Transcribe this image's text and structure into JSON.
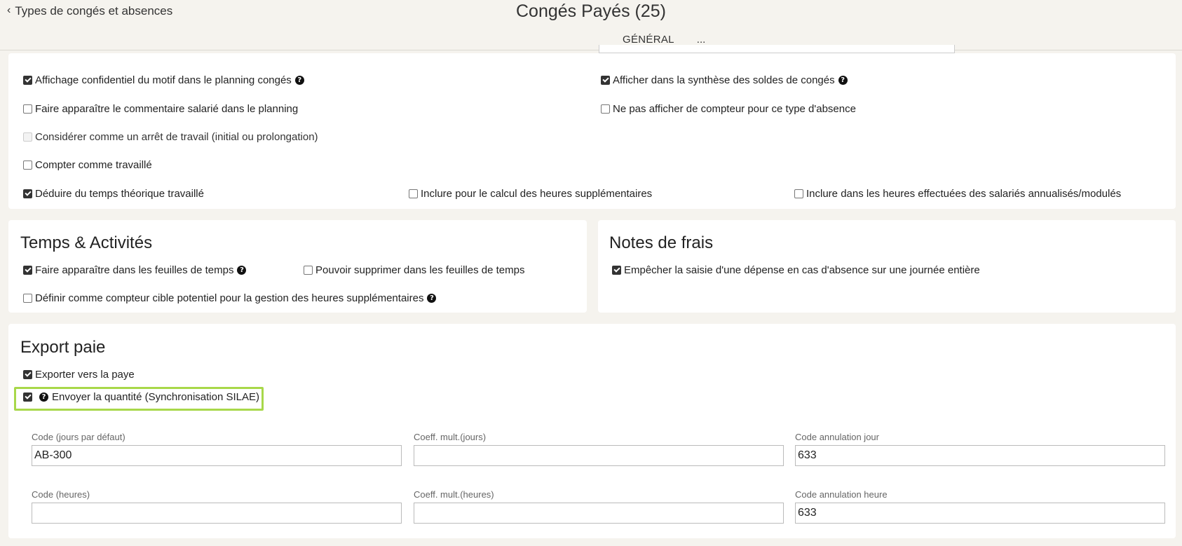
{
  "header": {
    "back_label": "Types de congés et absences",
    "title": "Congés Payés (25)",
    "tabs": [
      {
        "label": "GÉNÉRAL",
        "active": true
      },
      {
        "label": "..."
      }
    ]
  },
  "general": {
    "options": [
      {
        "label": "Affichage confidentiel du motif dans le planning congés",
        "checked": true,
        "help": true
      },
      {
        "label": "Afficher dans la synthèse des soldes de congés",
        "checked": true,
        "help": true
      },
      {
        "label": "Faire apparaître le commentaire salarié dans le planning",
        "checked": false
      },
      {
        "label": "Ne pas afficher de compteur pour ce type d'absence",
        "checked": false
      },
      {
        "label": "Considérer comme un arrêt de travail (initial ou prolongation)",
        "checked": false,
        "disabled": true
      },
      {
        "label": "Compter comme travaillé",
        "checked": false
      },
      {
        "label": "Déduire du temps théorique travaillé",
        "checked": true
      },
      {
        "label": "Inclure pour le calcul des heures supplémentaires",
        "checked": false
      },
      {
        "label": "Inclure dans les heures effectuées des salariés annualisés/modulés",
        "checked": false
      }
    ]
  },
  "temps_activites": {
    "title": "Temps & Activités",
    "options": [
      {
        "label": "Faire apparaître dans les feuilles de temps",
        "checked": true,
        "help": true
      },
      {
        "label": "Pouvoir supprimer dans les feuilles de temps",
        "checked": false
      },
      {
        "label": "Définir comme compteur cible potentiel pour la gestion des heures supplémentaires",
        "checked": false,
        "help": true
      }
    ]
  },
  "notes_frais": {
    "title": "Notes de frais",
    "options": [
      {
        "label": "Empêcher la saisie d'une dépense en cas d'absence sur une journée entière",
        "checked": true
      }
    ]
  },
  "export_paie": {
    "title": "Export paie",
    "options": [
      {
        "label": "Exporter vers la paye",
        "checked": true
      },
      {
        "label": "Envoyer la quantité (Synchronisation SILAE)",
        "checked": true,
        "help": true
      }
    ],
    "fields": [
      {
        "label": "Code (jours par défaut)",
        "value": "AB-300"
      },
      {
        "label": "Coeff. mult.(jours)",
        "value": ""
      },
      {
        "label": "Code annulation jour",
        "value": "633"
      },
      {
        "label": "Code (heures)",
        "value": ""
      },
      {
        "label": "Coeff. mult.(heures)",
        "value": ""
      },
      {
        "label": "Code annulation heure",
        "value": "633"
      }
    ]
  },
  "colors": {
    "background": "#f5f3ee",
    "highlight": "#a8d84a",
    "tab_underline": "#2f4b5a"
  }
}
